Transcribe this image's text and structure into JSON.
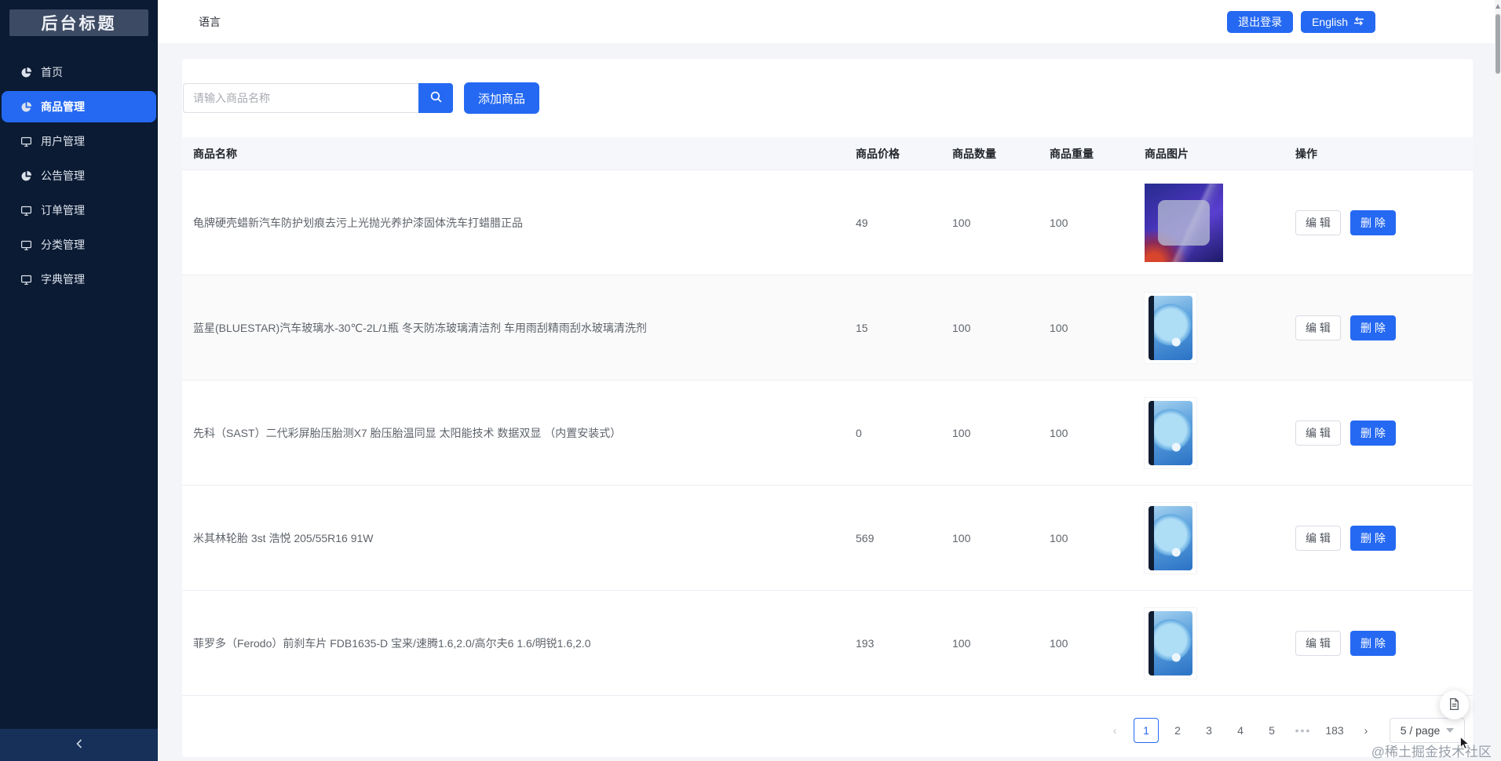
{
  "app": {
    "title": "后台标题"
  },
  "sidebar": {
    "items": [
      {
        "label": "首页",
        "icon": "pie-chart-icon",
        "active": false
      },
      {
        "label": "商品管理",
        "icon": "pie-chart-icon",
        "active": true
      },
      {
        "label": "用户管理",
        "icon": "monitor-icon",
        "active": false
      },
      {
        "label": "公告管理",
        "icon": "pie-chart-icon",
        "active": false
      },
      {
        "label": "订单管理",
        "icon": "monitor-icon",
        "active": false
      },
      {
        "label": "分类管理",
        "icon": "monitor-icon",
        "active": false
      },
      {
        "label": "字典管理",
        "icon": "monitor-icon",
        "active": false
      }
    ]
  },
  "header": {
    "language": "语言",
    "logout_button": "退出登录",
    "english_button": "English"
  },
  "toolbar": {
    "search_placeholder": "请输入商品名称",
    "add_product_button": "添加商品"
  },
  "table": {
    "columns": [
      "商品名称",
      "商品价格",
      "商品数量",
      "商品重量",
      "商品图片",
      "操作"
    ],
    "edit_button": "编 辑",
    "delete_button": "删 除",
    "rows": [
      {
        "name": "龟牌硬壳蜡新汽车防护划痕去污上光抛光养护漆固体洗车打蜡腊正品",
        "price": "49",
        "quantity": "100",
        "weight": "100",
        "image": "wax-purple",
        "striped": false
      },
      {
        "name": "蓝星(BLUESTAR)汽车玻璃水-30℃-2L/1瓶 冬天防冻玻璃清洁剂 车用雨刮精雨刮水玻璃清洗剂",
        "price": "15",
        "quantity": "100",
        "weight": "100",
        "image": "phone-blue",
        "striped": true
      },
      {
        "name": "先科（SAST）二代彩屏胎压胎测X7 胎压胎温同显 太阳能技术 数据双显 （内置安装式）",
        "price": "0",
        "quantity": "100",
        "weight": "100",
        "image": "phone-blue",
        "striped": false
      },
      {
        "name": "米其林轮胎 3st 浩悦 205/55R16 91W",
        "price": "569",
        "quantity": "100",
        "weight": "100",
        "image": "phone-blue",
        "striped": false
      },
      {
        "name": "菲罗多（Ferodo）前刹车片 FDB1635-D 宝来/速腾1.6,2.0/高尔夫6 1.6/明锐1.6,2.0",
        "price": "193",
        "quantity": "100",
        "weight": "100",
        "image": "phone-blue",
        "striped": false
      }
    ]
  },
  "pagination": {
    "prev_icon": "‹",
    "next_icon": "›",
    "pages": [
      {
        "label": "1",
        "active": true
      },
      {
        "label": "2",
        "active": false
      },
      {
        "label": "3",
        "active": false
      },
      {
        "label": "4",
        "active": false
      },
      {
        "label": "5",
        "active": false
      }
    ],
    "ellipsis": "•••",
    "last_page": "183",
    "page_size": "5 / page"
  },
  "watermark": "@稀土掘金技术社区",
  "colors": {
    "primary": "#2569f2",
    "sidebar_bg": "#0b1b33",
    "stripe": "#fafafa",
    "table_header_bg": "#f5f7fa"
  }
}
